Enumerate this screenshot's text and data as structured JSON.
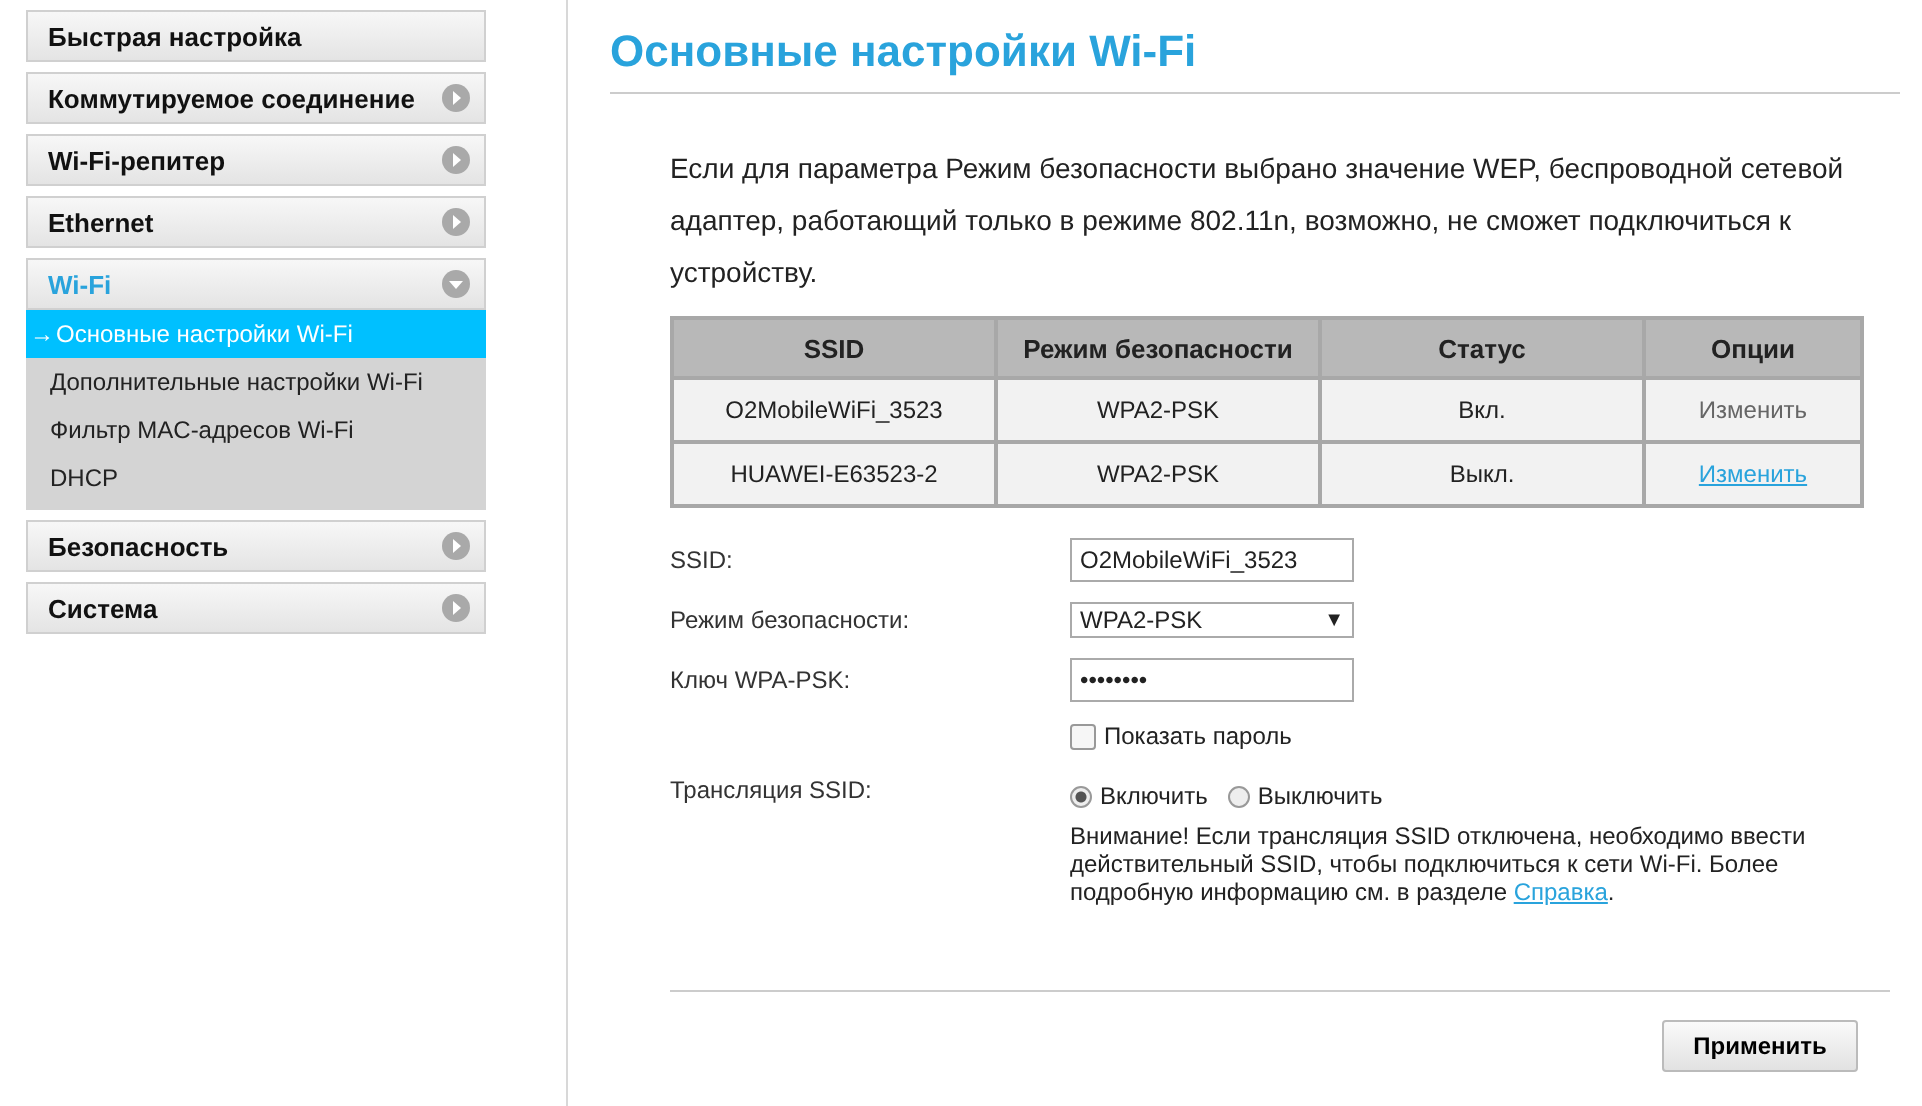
{
  "sidebar": {
    "current_marker": "→",
    "items": [
      {
        "label": "Быстрая настройка",
        "kind": "link"
      },
      {
        "label": "Коммутируемое соединение",
        "kind": "group",
        "expanded": false
      },
      {
        "label": "Wi-Fi-репитер",
        "kind": "group",
        "expanded": false
      },
      {
        "label": "Ethernet",
        "kind": "group",
        "expanded": false
      },
      {
        "label": "Wi-Fi",
        "kind": "group",
        "expanded": true,
        "children": [
          {
            "label": "Основные настройки Wi-Fi",
            "selected": true
          },
          {
            "label": "Дополнительные настройки Wi-Fi",
            "selected": false
          },
          {
            "label": "Фильтр MAC-адресов Wi-Fi",
            "selected": false
          },
          {
            "label": "DHCP",
            "selected": false
          }
        ]
      },
      {
        "label": "Безопасность",
        "kind": "group",
        "expanded": false
      },
      {
        "label": "Система",
        "kind": "group",
        "expanded": false
      }
    ]
  },
  "page": {
    "title": "Основные настройки Wi-Fi",
    "intro": "Если для параметра Режим безопасности выбрано значение WEP, беспроводной сетевой адаптер, работающий только в режиме 802.11n, возможно, не сможет подключиться к устройству.",
    "table": {
      "columns": [
        "SSID",
        "Режим безопасности",
        "Статус",
        "Опции"
      ],
      "rows": [
        {
          "ssid": "O2MobileWiFi_3523",
          "security": "WPA2-PSK",
          "status": "Вкл.",
          "option": {
            "label": "Изменить",
            "disabled": true
          }
        },
        {
          "ssid": "HUAWEI-E63523-2",
          "security": "WPA2-PSK",
          "status": "Выкл.",
          "option": {
            "label": "Изменить",
            "disabled": false
          }
        }
      ]
    },
    "form": {
      "ssid": {
        "label": "SSID:",
        "value": "O2MobileWiFi_3523"
      },
      "security": {
        "label": "Режим безопасности:",
        "value": "WPA2-PSK",
        "arrow": "▼"
      },
      "key": {
        "label": "Ключ WPA-PSK:",
        "value": "••••••••"
      },
      "show_password": {
        "label": "Показать пароль",
        "checked": false
      },
      "broadcast": {
        "label": "Трансляция SSID:",
        "options": [
          {
            "label": "Включить",
            "selected": true
          },
          {
            "label": "Выключить",
            "selected": false
          }
        ]
      },
      "note": {
        "text": "Внимание! Если трансляция SSID отключена, необходимо ввести действительный SSID, чтобы подключиться к сети Wi-Fi. Более подробную информацию см. в разделе",
        "link": "Справка",
        "after": "."
      }
    },
    "apply_button": "Применить"
  }
}
